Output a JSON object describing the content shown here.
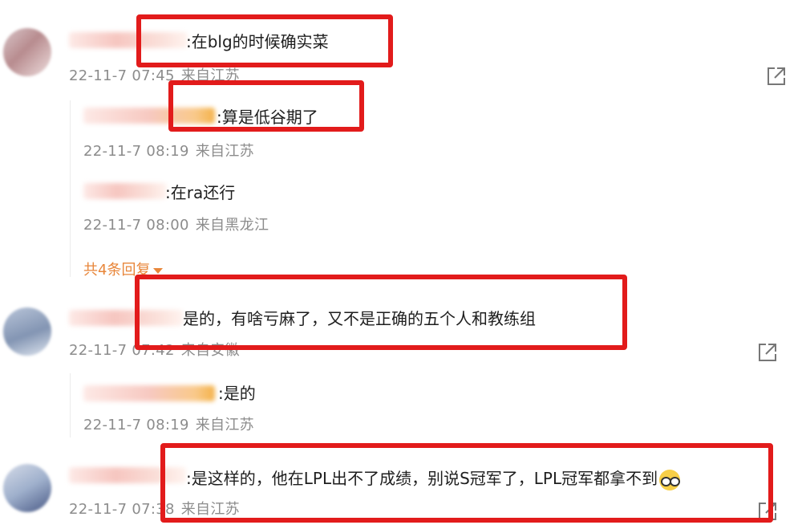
{
  "comments": [
    {
      "text": ":在blg的时候确实菜",
      "time": "22-11-7 07:45",
      "location": "来自江苏",
      "replies": [
        {
          "text": ":算是低谷期了",
          "time": "22-11-7 08:19",
          "location": "来自江苏"
        },
        {
          "text": ":在ra还行",
          "time": "22-11-7 08:00",
          "location": "来自黑龙江"
        }
      ],
      "more_replies": "共4条回复"
    },
    {
      "text": "是的，有啥亏麻了，又不是正确的五个人和教练组",
      "time": "22-11-7 07:42",
      "location": "来自安徽",
      "replies": [
        {
          "text": ":是的",
          "time": "22-11-7 08:19",
          "location": "来自江苏"
        }
      ]
    },
    {
      "text": ":是这样的，他在LPL出不了成绩，别说S冠军了，LPL冠军都拿不到",
      "time": "22-11-7 07:38",
      "location": "来自江苏"
    }
  ],
  "icons": {
    "share": "share-icon",
    "emoji": "glasses-emoji-icon"
  },
  "colors": {
    "highlight_box": "#e21b1b",
    "meta_text": "#8c8c8c",
    "more_link": "#e8863a"
  }
}
